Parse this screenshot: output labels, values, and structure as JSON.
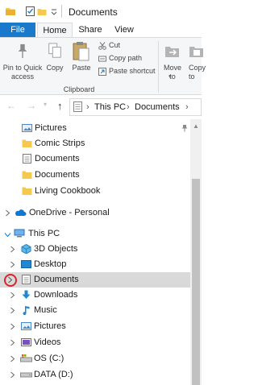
{
  "window": {
    "title": "Documents"
  },
  "ribbon_tabs": [
    "File",
    "Home",
    "Share",
    "View"
  ],
  "ribbon": {
    "pin_label": "Pin to Quick access",
    "copy_label": "Copy",
    "paste_label": "Paste",
    "cut_label": "Cut",
    "copy_path_label": "Copy path",
    "paste_shortcut_label": "Paste shortcut",
    "clipboard_group": "Clipboard",
    "move_to_label": "Move to",
    "copy_to_label": "Copy to"
  },
  "address": {
    "crumbs": [
      "This PC",
      "Documents"
    ]
  },
  "tree": {
    "quick_access": [
      "Pictures",
      "Comic Strips",
      "Documents",
      "Documents",
      "Living Cookbook"
    ],
    "onedrive": "OneDrive - Personal",
    "this_pc": "This PC",
    "this_pc_items": [
      "3D Objects",
      "Desktop",
      "Documents",
      "Downloads",
      "Music",
      "Pictures",
      "Videos",
      "OS (C:)",
      "DATA (D:)"
    ]
  },
  "colors": {
    "accent": "#1979ca",
    "selection": "#d9d9d9",
    "highlight_circle": "#d9232d",
    "folder": "#f4c94e"
  }
}
